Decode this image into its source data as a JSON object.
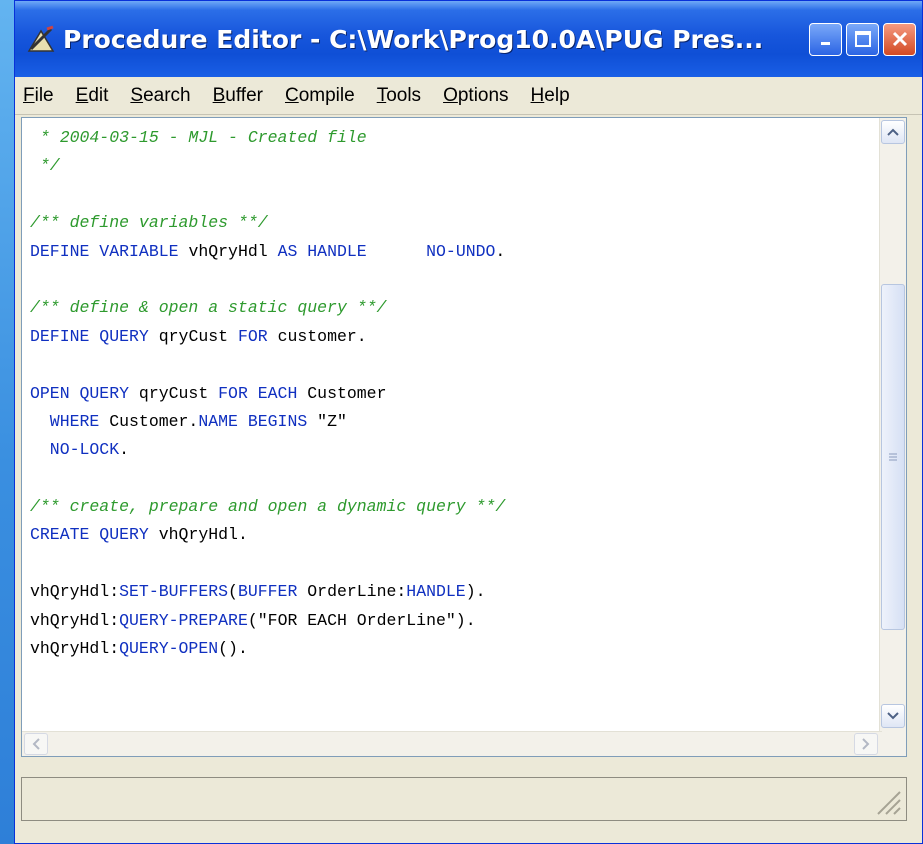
{
  "window": {
    "title": "Procedure Editor - C:\\Work\\Prog10.0A\\PUG Pres...",
    "controls": {
      "minimize_icon": "minimize-icon",
      "maximize_icon": "maximize-icon",
      "close_icon": "close-icon"
    }
  },
  "menu": [
    {
      "label_mn": "F",
      "label_rest": "ile"
    },
    {
      "label_mn": "E",
      "label_rest": "dit"
    },
    {
      "label_mn": "S",
      "label_rest": "earch"
    },
    {
      "label_mn": "B",
      "label_rest": "uffer"
    },
    {
      "label_mn": "C",
      "label_rest": "ompile"
    },
    {
      "label_mn": "T",
      "label_rest": "ools"
    },
    {
      "label_mn": "O",
      "label_rest": "ptions"
    },
    {
      "label_mn": "H",
      "label_rest": "elp"
    }
  ],
  "code": {
    "lines": [
      [
        {
          "t": " * 2004-03-15 - MJL - Created file",
          "c": "cm"
        }
      ],
      [
        {
          "t": " */",
          "c": "cm"
        }
      ],
      [],
      [
        {
          "t": "/** define variables **/",
          "c": "cm"
        }
      ],
      [
        {
          "t": "DEFINE VARIABLE ",
          "c": "kw"
        },
        {
          "t": "vhQryHdl ",
          "c": "st"
        },
        {
          "t": "AS HANDLE",
          "c": "kw"
        },
        {
          "t": "      ",
          "c": "st"
        },
        {
          "t": "NO-UNDO",
          "c": "kw"
        },
        {
          "t": ".",
          "c": "st"
        }
      ],
      [],
      [
        {
          "t": "/** define & open a static query **/",
          "c": "cm"
        }
      ],
      [
        {
          "t": "DEFINE QUERY ",
          "c": "kw"
        },
        {
          "t": "qryCust ",
          "c": "st"
        },
        {
          "t": "FOR ",
          "c": "kw"
        },
        {
          "t": "customer.",
          "c": "st"
        }
      ],
      [],
      [
        {
          "t": "OPEN QUERY ",
          "c": "kw"
        },
        {
          "t": "qryCust ",
          "c": "st"
        },
        {
          "t": "FOR EACH ",
          "c": "kw"
        },
        {
          "t": "Customer",
          "c": "st"
        }
      ],
      [
        {
          "t": "  WHERE ",
          "c": "kw"
        },
        {
          "t": "Customer.",
          "c": "st"
        },
        {
          "t": "NAME BEGINS ",
          "c": "kw"
        },
        {
          "t": "\"Z\"",
          "c": "st"
        }
      ],
      [
        {
          "t": "  NO-LOCK",
          "c": "kw"
        },
        {
          "t": ".",
          "c": "st"
        }
      ],
      [],
      [
        {
          "t": "/** create, prepare and open a dynamic query **/",
          "c": "cm"
        }
      ],
      [
        {
          "t": "CREATE QUERY ",
          "c": "kw"
        },
        {
          "t": "vhQryHdl.",
          "c": "st"
        }
      ],
      [],
      [
        {
          "t": "vhQryHdl:",
          "c": "st"
        },
        {
          "t": "SET-BUFFERS",
          "c": "kw"
        },
        {
          "t": "(",
          "c": "st"
        },
        {
          "t": "BUFFER ",
          "c": "kw"
        },
        {
          "t": "OrderLine:",
          "c": "st"
        },
        {
          "t": "HANDLE",
          "c": "kw"
        },
        {
          "t": ").",
          "c": "st"
        }
      ],
      [
        {
          "t": "vhQryHdl:",
          "c": "st"
        },
        {
          "t": "QUERY-PREPARE",
          "c": "kw"
        },
        {
          "t": "(\"FOR EACH OrderLine\").",
          "c": "st"
        }
      ],
      [
        {
          "t": "vhQryHdl:",
          "c": "st"
        },
        {
          "t": "QUERY-OPEN",
          "c": "kw"
        },
        {
          "t": "().",
          "c": "st"
        }
      ]
    ]
  },
  "status": {
    "text": ""
  },
  "colors": {
    "keyword": "#1030c0",
    "comment": "#2e9a2e",
    "title_bar": "#0f4fd6"
  }
}
